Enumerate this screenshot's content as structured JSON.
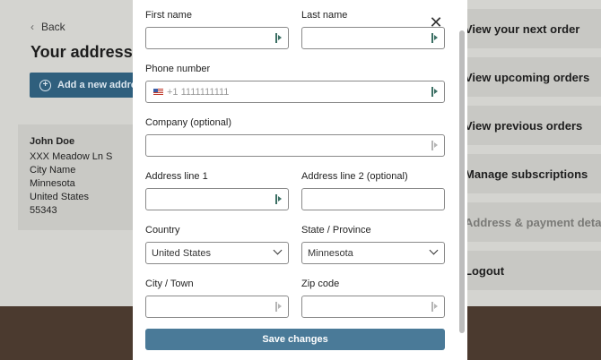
{
  "background": {
    "back_label": "Back",
    "page_title": "Your addresses",
    "add_button_label": "Add a new address",
    "address_card": {
      "name": "John Doe",
      "street": "XXX Meadow Ln S",
      "city": "City Name",
      "state": "Minnesota",
      "country": "United States",
      "zip": "55343"
    },
    "menu": [
      {
        "label": "View your next order"
      },
      {
        "label": "View upcoming orders"
      },
      {
        "label": "View previous orders"
      },
      {
        "label": "Manage subscriptions"
      },
      {
        "label": "Address & payment details"
      },
      {
        "label": "Logout"
      }
    ]
  },
  "modal": {
    "close_icon": "close-icon",
    "fields": {
      "first_name": {
        "label": "First name",
        "value": ""
      },
      "last_name": {
        "label": "Last name",
        "value": ""
      },
      "phone": {
        "label": "Phone number",
        "placeholder": "+1 1111111111",
        "flag": "us-flag"
      },
      "company": {
        "label": "Company (optional)",
        "value": ""
      },
      "address1": {
        "label": "Address line 1",
        "value": ""
      },
      "address2": {
        "label": "Address line 2 (optional)",
        "value": ""
      },
      "country": {
        "label": "Country",
        "value": "United States"
      },
      "state": {
        "label": "State / Province",
        "value": "Minnesota"
      },
      "city": {
        "label": "City / Town",
        "value": ""
      },
      "zip": {
        "label": "Zip code",
        "value": ""
      }
    },
    "save_label": "Save changes"
  },
  "colors": {
    "primary_button": "#4a7a98",
    "add_button": "#2f5f7d",
    "footer_band": "#4b3a2f",
    "backdrop": "#d4d4d0"
  }
}
